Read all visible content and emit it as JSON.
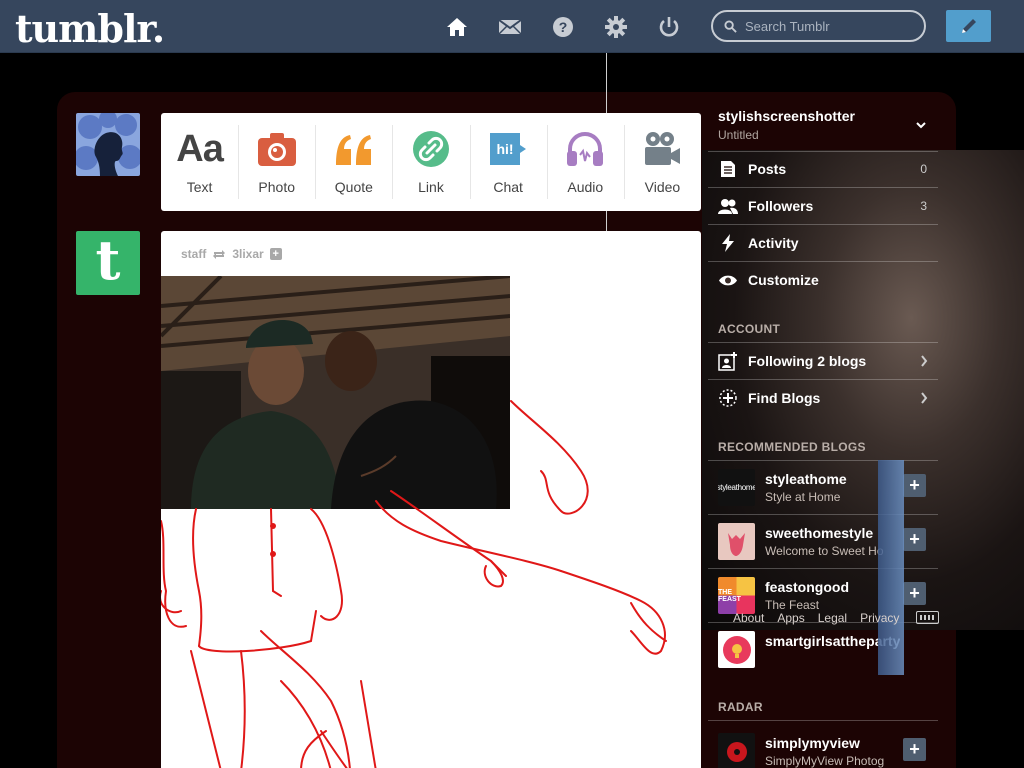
{
  "header": {
    "logo": "tumblr.",
    "nav_icons": [
      "home-icon",
      "mail-icon",
      "help-icon",
      "gear-icon",
      "power-icon"
    ],
    "search_placeholder": "Search Tumblr",
    "compose_icon": "pencil-icon"
  },
  "composer": {
    "types": [
      {
        "label": "Text",
        "icon": "text-aa-icon",
        "color": "#444444"
      },
      {
        "label": "Photo",
        "icon": "camera-icon",
        "color": "#d95e40"
      },
      {
        "label": "Quote",
        "icon": "quote-icon",
        "color": "#f2992e"
      },
      {
        "label": "Link",
        "icon": "link-icon",
        "color": "#56bc8a"
      },
      {
        "label": "Chat",
        "icon": "chat-hi-icon",
        "color": "#529ecc"
      },
      {
        "label": "Audio",
        "icon": "headphones-icon",
        "color": "#a77dc2"
      },
      {
        "label": "Video",
        "icon": "video-camera-icon",
        "color": "#748089"
      }
    ]
  },
  "post": {
    "author": "staff",
    "reblog_icon": "reblog-icon",
    "source": "3lixar",
    "follow_icon": "plus-icon"
  },
  "sidebar": {
    "account": {
      "name": "stylishscreenshotter",
      "title": "Untitled"
    },
    "items": [
      {
        "label": "Posts",
        "icon": "posts-icon",
        "count": "0"
      },
      {
        "label": "Followers",
        "icon": "followers-icon",
        "count": "3"
      },
      {
        "label": "Activity",
        "icon": "activity-icon",
        "count": ""
      },
      {
        "label": "Customize",
        "icon": "eye-icon",
        "count": ""
      }
    ],
    "account_heading": "ACCOUNT",
    "account_items": [
      {
        "label": "Following 2 blogs",
        "icon": "following-icon"
      },
      {
        "label": "Find Blogs",
        "icon": "find-blogs-icon"
      }
    ],
    "recommended_heading": "RECOMMENDED BLOGS",
    "recommended": [
      {
        "name": "styleathome",
        "subtitle": "Style at Home",
        "avatar_text": "styleathome",
        "avatar_color": "#111111"
      },
      {
        "name": "sweethomestyle",
        "subtitle": "Welcome to Sweet Ho",
        "avatar_text": "",
        "avatar_color": "#e8c8c0"
      },
      {
        "name": "feastongood",
        "subtitle": "The Feast",
        "avatar_text": "THE FEAST",
        "avatar_color": "#e8345e"
      },
      {
        "name": "smartgirlsattheparty",
        "subtitle": "",
        "avatar_text": "",
        "avatar_color": "#e83a5c"
      }
    ],
    "radar_heading": "RADAR",
    "radar": [
      {
        "name": "simplymyview",
        "subtitle": "SimplyMyView Photog",
        "avatar_color": "#111111"
      }
    ],
    "footer_links": [
      "About",
      "Apps",
      "Legal",
      "Privacy"
    ]
  }
}
